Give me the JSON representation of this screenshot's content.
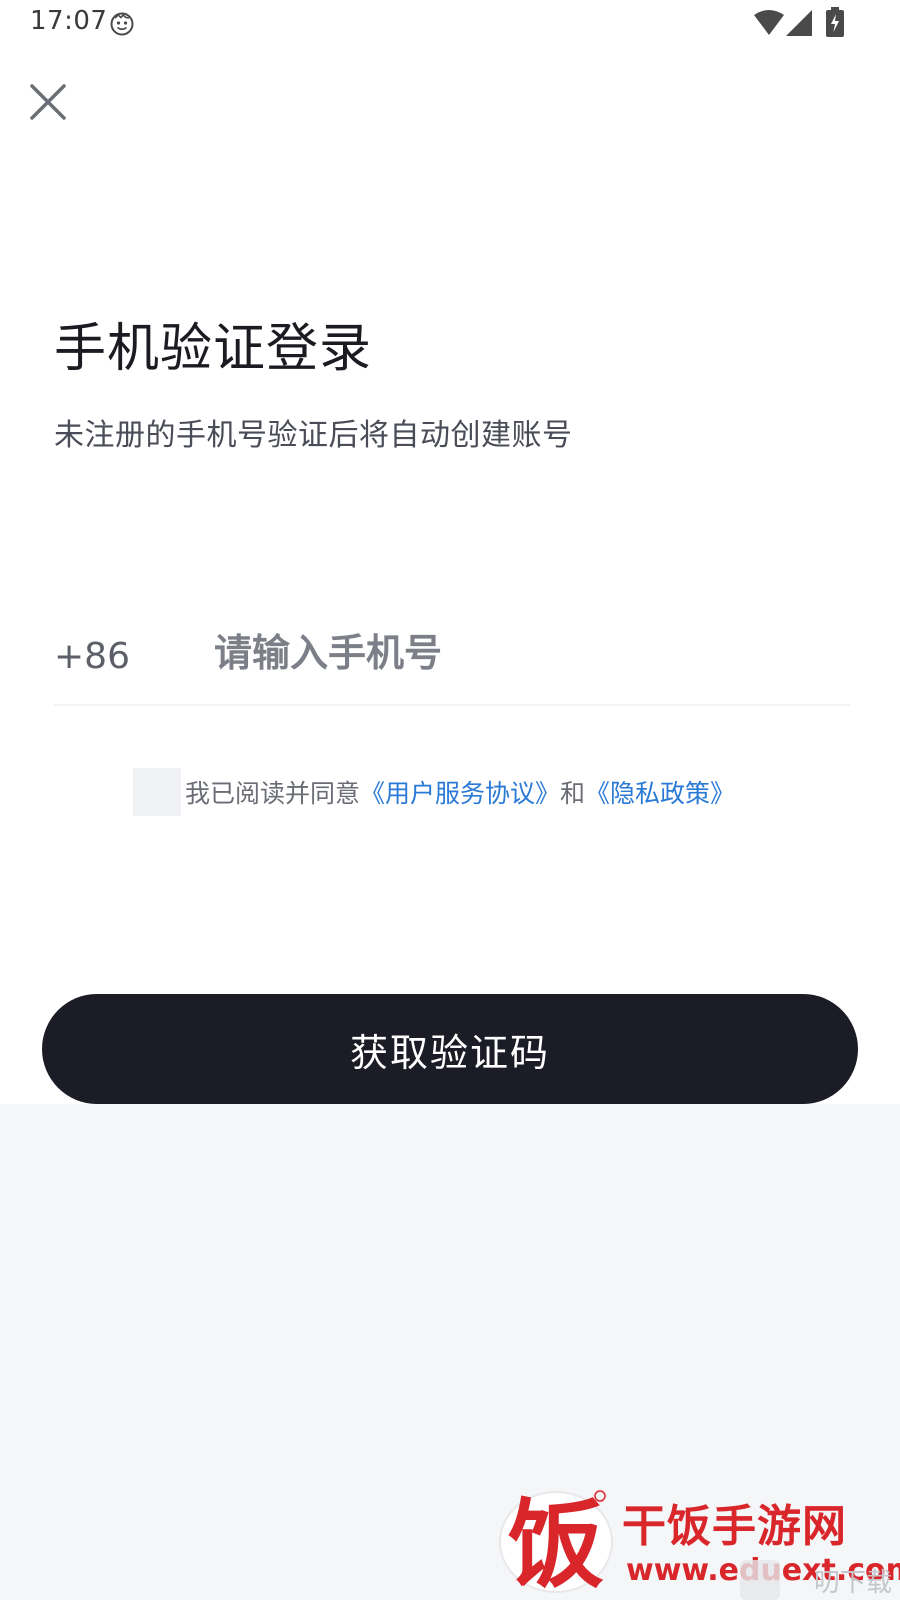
{
  "status_bar": {
    "time": "17:07",
    "icons": [
      "face-icon",
      "wifi-icon",
      "signal-icon",
      "battery-charging-icon"
    ]
  },
  "header": {
    "close_icon": "close-icon"
  },
  "login": {
    "title": "手机验证登录",
    "subtitle": "未注册的手机号验证后将自动创建账号",
    "country_code": "+86",
    "phone_value": "",
    "phone_placeholder": "请输入手机号"
  },
  "agreement": {
    "checked": false,
    "prefix": "我已阅读并同意",
    "user_agreement_link": "《用户服务协议》",
    "conjunction": "和",
    "privacy_policy_link": "《隐私政策》"
  },
  "actions": {
    "get_code_label": "获取验证码"
  },
  "watermark": {
    "brand": "干饭手游网",
    "url": "www.eduext.com",
    "faint_text": "叨下载"
  },
  "colors": {
    "primary_button": "#1b1c26",
    "link": "#2a7ad6",
    "brand_red": "#d8262b",
    "lower_background": "#f5f6f8"
  }
}
